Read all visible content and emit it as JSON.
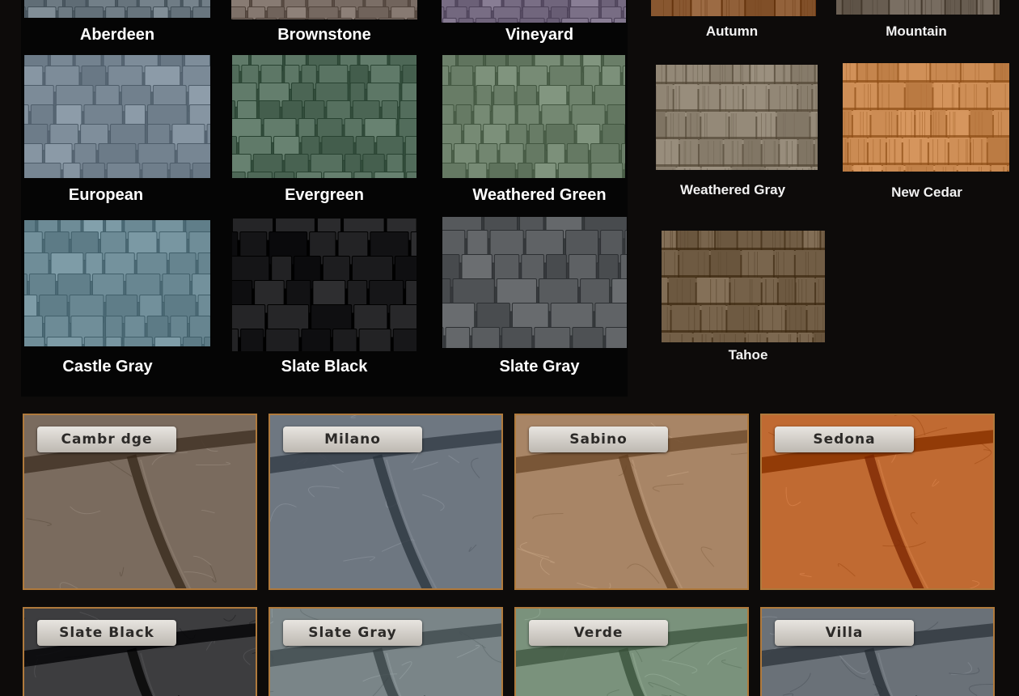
{
  "slate_swatches": [
    {
      "name": "Aberdeen",
      "color": "#6f7c85"
    },
    {
      "name": "Brownstone",
      "color": "#7d7068"
    },
    {
      "name": "Vineyard",
      "color": "#7a6f86"
    },
    {
      "name": "European",
      "color": "#7b8a97"
    },
    {
      "name": "Evergreen",
      "color": "#56705f"
    },
    {
      "name": "Weathered Green",
      "color": "#6f836d"
    },
    {
      "name": "Castle Gray",
      "color": "#6f8d98"
    },
    {
      "name": "Slate Black",
      "color": "#1c1c1e"
    },
    {
      "name": "Slate Gray",
      "color": "#5a5d60"
    }
  ],
  "shake_swatches": [
    {
      "name": "Autumn",
      "color": "#8e5d36"
    },
    {
      "name": "Mountain",
      "color": "#6c6155"
    },
    {
      "name": "Weathered Gray",
      "color": "#8d8271"
    },
    {
      "name": "New Cedar",
      "color": "#c88850"
    },
    {
      "name": "Tahoe",
      "color": "#76624a"
    }
  ],
  "stone_cards": [
    {
      "name": "Cambr dge",
      "color": "#7a6b5e"
    },
    {
      "name": "Milano",
      "color": "#6e7781"
    },
    {
      "name": "Sabino",
      "color": "#a88566"
    },
    {
      "name": "Sedona",
      "color": "#c06a32"
    },
    {
      "name": "Slate Black",
      "color": "#3d3d3f"
    },
    {
      "name": "Slate Gray",
      "color": "#7a8588"
    },
    {
      "name": "Verde",
      "color": "#7a927c"
    },
    {
      "name": "Villa",
      "color": "#6a7178"
    }
  ]
}
